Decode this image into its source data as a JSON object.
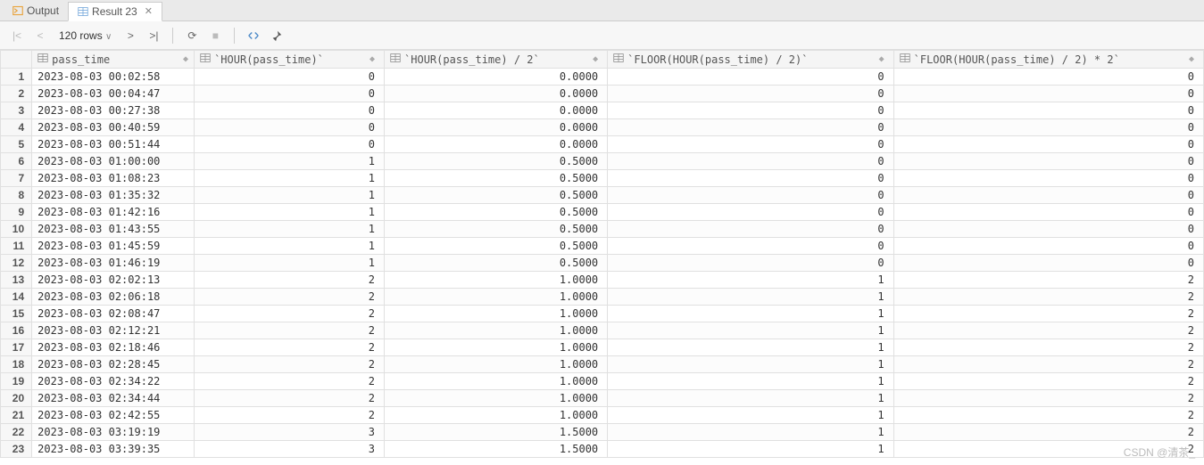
{
  "tabs": [
    {
      "label": "Output",
      "active": false
    },
    {
      "label": "Result 23",
      "active": true,
      "closable": true
    }
  ],
  "toolbar": {
    "nav_first": "|<",
    "nav_prev": "<",
    "rows_label": "120 rows",
    "rows_caret": "∨",
    "nav_next": ">",
    "nav_last": ">|",
    "refresh": "⟳",
    "stop": "■",
    "expand": "⤢",
    "pin": "📌"
  },
  "columns": [
    {
      "key": "pass_time",
      "label": "pass_time",
      "cls": "c-time"
    },
    {
      "key": "hour",
      "label": "`HOUR(pass_time)`",
      "cls": "c-num w-a"
    },
    {
      "key": "hour2",
      "label": "`HOUR(pass_time) / 2`",
      "cls": "c-num w-b"
    },
    {
      "key": "floor",
      "label": "`FLOOR(HOUR(pass_time) / 2)`",
      "cls": "c-num w-c"
    },
    {
      "key": "floorx2",
      "label": "`FLOOR(HOUR(pass_time) / 2) * 2`",
      "cls": "c-num w-d"
    }
  ],
  "rows": [
    {
      "pass_time": "2023-08-03 00:02:58",
      "hour": "0",
      "hour2": "0.0000",
      "floor": "0",
      "floorx2": "0"
    },
    {
      "pass_time": "2023-08-03 00:04:47",
      "hour": "0",
      "hour2": "0.0000",
      "floor": "0",
      "floorx2": "0"
    },
    {
      "pass_time": "2023-08-03 00:27:38",
      "hour": "0",
      "hour2": "0.0000",
      "floor": "0",
      "floorx2": "0"
    },
    {
      "pass_time": "2023-08-03 00:40:59",
      "hour": "0",
      "hour2": "0.0000",
      "floor": "0",
      "floorx2": "0"
    },
    {
      "pass_time": "2023-08-03 00:51:44",
      "hour": "0",
      "hour2": "0.0000",
      "floor": "0",
      "floorx2": "0"
    },
    {
      "pass_time": "2023-08-03 01:00:00",
      "hour": "1",
      "hour2": "0.5000",
      "floor": "0",
      "floorx2": "0"
    },
    {
      "pass_time": "2023-08-03 01:08:23",
      "hour": "1",
      "hour2": "0.5000",
      "floor": "0",
      "floorx2": "0"
    },
    {
      "pass_time": "2023-08-03 01:35:32",
      "hour": "1",
      "hour2": "0.5000",
      "floor": "0",
      "floorx2": "0"
    },
    {
      "pass_time": "2023-08-03 01:42:16",
      "hour": "1",
      "hour2": "0.5000",
      "floor": "0",
      "floorx2": "0"
    },
    {
      "pass_time": "2023-08-03 01:43:55",
      "hour": "1",
      "hour2": "0.5000",
      "floor": "0",
      "floorx2": "0"
    },
    {
      "pass_time": "2023-08-03 01:45:59",
      "hour": "1",
      "hour2": "0.5000",
      "floor": "0",
      "floorx2": "0"
    },
    {
      "pass_time": "2023-08-03 01:46:19",
      "hour": "1",
      "hour2": "0.5000",
      "floor": "0",
      "floorx2": "0"
    },
    {
      "pass_time": "2023-08-03 02:02:13",
      "hour": "2",
      "hour2": "1.0000",
      "floor": "1",
      "floorx2": "2"
    },
    {
      "pass_time": "2023-08-03 02:06:18",
      "hour": "2",
      "hour2": "1.0000",
      "floor": "1",
      "floorx2": "2"
    },
    {
      "pass_time": "2023-08-03 02:08:47",
      "hour": "2",
      "hour2": "1.0000",
      "floor": "1",
      "floorx2": "2"
    },
    {
      "pass_time": "2023-08-03 02:12:21",
      "hour": "2",
      "hour2": "1.0000",
      "floor": "1",
      "floorx2": "2"
    },
    {
      "pass_time": "2023-08-03 02:18:46",
      "hour": "2",
      "hour2": "1.0000",
      "floor": "1",
      "floorx2": "2"
    },
    {
      "pass_time": "2023-08-03 02:28:45",
      "hour": "2",
      "hour2": "1.0000",
      "floor": "1",
      "floorx2": "2"
    },
    {
      "pass_time": "2023-08-03 02:34:22",
      "hour": "2",
      "hour2": "1.0000",
      "floor": "1",
      "floorx2": "2"
    },
    {
      "pass_time": "2023-08-03 02:34:44",
      "hour": "2",
      "hour2": "1.0000",
      "floor": "1",
      "floorx2": "2"
    },
    {
      "pass_time": "2023-08-03 02:42:55",
      "hour": "2",
      "hour2": "1.0000",
      "floor": "1",
      "floorx2": "2"
    },
    {
      "pass_time": "2023-08-03 03:19:19",
      "hour": "3",
      "hour2": "1.5000",
      "floor": "1",
      "floorx2": "2"
    },
    {
      "pass_time": "2023-08-03 03:39:35",
      "hour": "3",
      "hour2": "1.5000",
      "floor": "1",
      "floorx2": "2"
    }
  ],
  "watermark": "CSDN @清茶_"
}
